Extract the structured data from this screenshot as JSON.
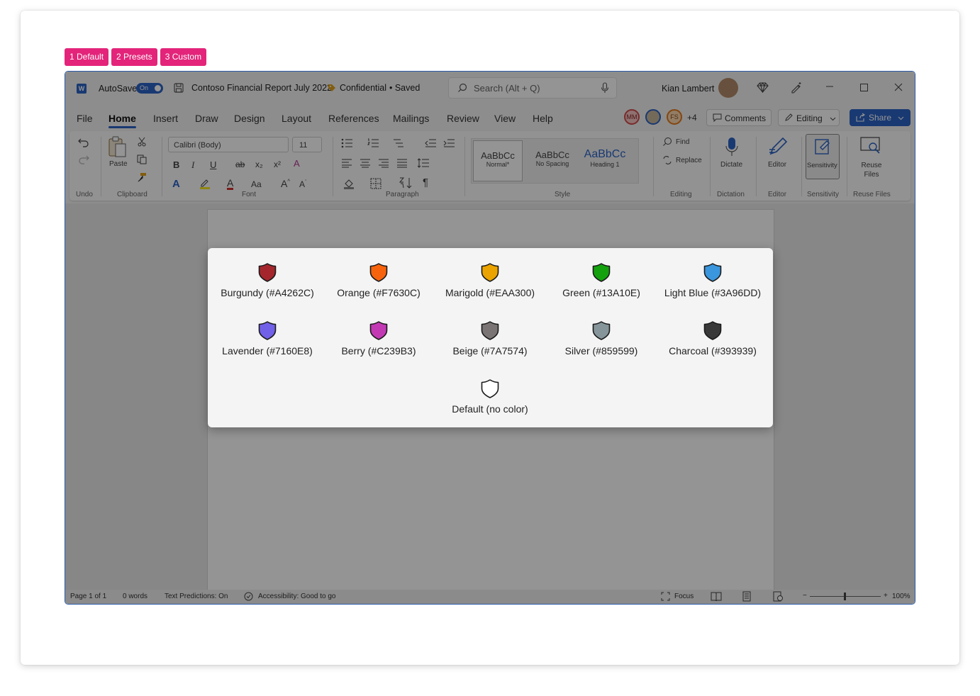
{
  "tabs": [
    "1 Default",
    "2 Presets",
    "3 Custom"
  ],
  "titlebar": {
    "app_letter": "W",
    "autosave_label": "AutoSave",
    "autosave_state": "On",
    "doc_title": "Contoso Financial Report July 2022",
    "confidential": "Confidential",
    "saved": "• Saved",
    "search_placeholder": "Search (Alt + Q)",
    "user_name": "Kian Lambert"
  },
  "menu": {
    "items": [
      "File",
      "Home",
      "Insert",
      "Draw",
      "Design",
      "Layout",
      "References",
      "Mailings",
      "Review",
      "View",
      "Help"
    ],
    "active": "Home",
    "presence": [
      "MM",
      "",
      "FS"
    ],
    "presence_extra": "+4",
    "comments": "Comments",
    "editing": "Editing",
    "share": "Share"
  },
  "ribbon": {
    "groups": [
      "Undo",
      "Clipboard",
      "Font",
      "Paragraph",
      "Style",
      "Editing",
      "Dictation",
      "Editor",
      "Sensitivity",
      "Reuse Files"
    ],
    "paste": "Paste",
    "font_name": "Calibri (Body)",
    "font_size": "11",
    "styles": [
      {
        "sample": "AaBbCc",
        "name": "Normal*"
      },
      {
        "sample": "AaBbCc",
        "name": "No Spacing"
      },
      {
        "sample": "AaBbCc",
        "name": "Heading 1"
      }
    ],
    "find": "Find",
    "replace": "Replace",
    "dictate": "Dictate",
    "editor": "Editor",
    "sensitivity": "Sensitivity",
    "reuse_files": "Reuse Files"
  },
  "statusbar": {
    "page": "Page 1 of 1",
    "words": "0 words",
    "predictions": "Text Predictions: On",
    "accessibility": "Accessibility: Good to go",
    "focus": "Focus",
    "zoom": "100%"
  },
  "palette": [
    {
      "label": "Burgundy (#A4262C)",
      "color": "#A4262C"
    },
    {
      "label": "Orange (#F7630C)",
      "color": "#F7630C"
    },
    {
      "label": "Marigold (#EAA300)",
      "color": "#EAA300"
    },
    {
      "label": "Green (#13A10E)",
      "color": "#13A10E"
    },
    {
      "label": "Light Blue (#3A96DD)",
      "color": "#3A96DD"
    },
    {
      "label": "Lavender (#7160E8)",
      "color": "#7160E8"
    },
    {
      "label": "Berry (#C239B3)",
      "color": "#C239B3"
    },
    {
      "label": "Beige (#7A7574)",
      "color": "#7A7574"
    },
    {
      "label": "Silver (#859599)",
      "color": "#859599"
    },
    {
      "label": "Charcoal (#393939)",
      "color": "#393939"
    },
    {
      "label": "Default (no color)",
      "color": "#FFFFFF"
    }
  ]
}
